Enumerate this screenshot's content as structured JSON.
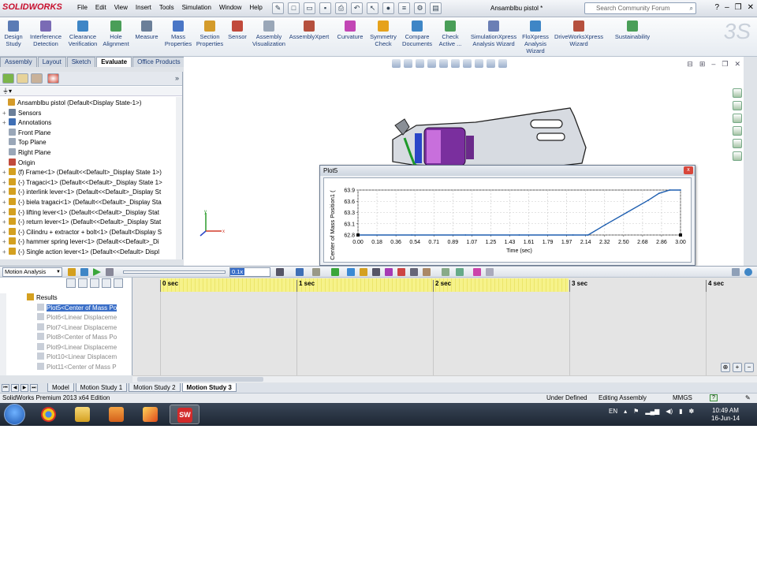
{
  "app": {
    "logo": "SOLIDWORKS",
    "menu": [
      "File",
      "Edit",
      "View",
      "Insert",
      "Tools",
      "Simulation",
      "Window",
      "Help"
    ],
    "document_title": "Ansamblbu pistol *",
    "search_placeholder": "Search Community Forum"
  },
  "ribbon": {
    "buttons": [
      {
        "label": "Design Study",
        "color": "#5b7bb5"
      },
      {
        "label": "Interference Detection",
        "color": "#7a6bb5"
      },
      {
        "label": "Clearance Verification",
        "color": "#3f86c6"
      },
      {
        "label": "Hole Alignment",
        "color": "#4a9e58"
      },
      {
        "label": "Measure",
        "color": "#6b7f99"
      },
      {
        "label": "Mass Properties",
        "color": "#4a76c6"
      },
      {
        "label": "Section Properties",
        "color": "#d49b2b"
      },
      {
        "label": "Sensor",
        "color": "#c14a3c"
      },
      {
        "label": "Assembly Visualization",
        "color": "#9aa7b8"
      },
      {
        "label": "AssemblyXpert",
        "color": "#b5503e"
      },
      {
        "label": "Curvature",
        "color": "#c246b5"
      },
      {
        "label": "Symmetry Check",
        "color": "#e6a21c"
      },
      {
        "label": "Compare Documents",
        "color": "#3f86c6"
      },
      {
        "label": "Check Active ...",
        "color": "#4a9e58"
      },
      {
        "label": "SimulationXpress Analysis Wizard",
        "color": "#6b7fb5"
      },
      {
        "label": "FloXpress Analysis Wizard",
        "color": "#3f86c6"
      },
      {
        "label": "DriveWorksXpress Wizard",
        "color": "#b5503e"
      },
      {
        "label": "Sustainability",
        "color": "#4a9e58"
      }
    ],
    "tabs": [
      "Assembly",
      "Layout",
      "Sketch",
      "Evaluate",
      "Office Products",
      "Simulation"
    ],
    "active_tab": "Evaluate"
  },
  "feature_tree": {
    "filter": "",
    "rows": [
      {
        "exp": "",
        "label": "Ansamblbu pistol  (Default<Display State-1>)",
        "color": "#d49b2b"
      },
      {
        "exp": "+",
        "label": "Sensors",
        "color": "#6b7f99"
      },
      {
        "exp": "+",
        "label": "Annotations",
        "color": "#3f6fb5"
      },
      {
        "exp": "",
        "label": "Front Plane",
        "color": "#9aa7b8"
      },
      {
        "exp": "",
        "label": "Top Plane",
        "color": "#9aa7b8"
      },
      {
        "exp": "",
        "label": "Right Plane",
        "color": "#9aa7b8"
      },
      {
        "exp": "",
        "label": "Origin",
        "color": "#c14a3c"
      },
      {
        "exp": "+",
        "label": "(f) Frame<1> (Default<<Default>_Display State 1>)",
        "color": "#d4a020"
      },
      {
        "exp": "+",
        "label": "(-) Tragaci<1> (Default<<Default>_Display State 1>",
        "color": "#d4a020"
      },
      {
        "exp": "+",
        "label": "(-) interlink lever<1> (Default<<Default>_Display St",
        "color": "#d4a020"
      },
      {
        "exp": "+",
        "label": "(-) biela tragaci<1> (Default<<Default>_Display Sta",
        "color": "#d4a020"
      },
      {
        "exp": "+",
        "label": "(-) lifting lever<1> (Default<<Default>_Display Stat",
        "color": "#d4a020"
      },
      {
        "exp": "+",
        "label": "(-) return lever<1> (Default<<Default>_Display Stat",
        "color": "#d4a020"
      },
      {
        "exp": "+",
        "label": "(-) Cilindru + extractor + bolt<1> (Default<Display S",
        "color": "#d4a020"
      },
      {
        "exp": "+",
        "label": "(-) hammer spring lever<1> (Default<<Default>_Di",
        "color": "#d4a020"
      },
      {
        "exp": "+",
        "label": "(-) Single action lever<1> (Default<<Default> Displ",
        "color": "#d4a020"
      }
    ]
  },
  "plot": {
    "window_title": "Plot5",
    "close_glyph": "x"
  },
  "chart_data": {
    "type": "line",
    "title": "",
    "xlabel": "Time (sec)",
    "ylabel": "Center of Mass Position1 (",
    "x_ticks": [
      "0.00",
      "0.18",
      "0.36",
      "0.54",
      "0.71",
      "0.89",
      "1.07",
      "1.25",
      "1.43",
      "1.61",
      "1.79",
      "1.97",
      "2.14",
      "2.32",
      "2.50",
      "2.68",
      "2.86",
      "3.00"
    ],
    "y_ticks": [
      "62.8",
      "63.1",
      "63.3",
      "63.6",
      "63.9"
    ],
    "xlim": [
      0,
      3.0
    ],
    "ylim": [
      62.8,
      63.9
    ],
    "grid": true,
    "series": [
      {
        "color": "#1f5fb0",
        "x": [
          0.0,
          0.5,
          1.0,
          1.5,
          2.0,
          2.14,
          2.3,
          2.5,
          2.7,
          2.8,
          2.9,
          3.0
        ],
        "y": [
          62.8,
          62.8,
          62.8,
          62.8,
          62.8,
          62.8,
          63.05,
          63.35,
          63.65,
          63.82,
          63.9,
          63.9
        ]
      }
    ]
  },
  "motion": {
    "study_type": "Motion Analysis",
    "zoom_value": "0.1x",
    "tree": [
      {
        "label": "Results",
        "kind": "res"
      },
      {
        "label": "Plot5<Center of Mass Po",
        "kind": "sel"
      },
      {
        "label": "Plot6<Linear Displaceme",
        "kind": ""
      },
      {
        "label": "Plot7<Linear Displaceme",
        "kind": ""
      },
      {
        "label": "Plot8<Center of Mass Po",
        "kind": ""
      },
      {
        "label": "Plot9<Linear Displaceme",
        "kind": ""
      },
      {
        "label": "Plot10<Linear Displacem",
        "kind": ""
      },
      {
        "label": "Plot11<Center of Mass P",
        "kind": ""
      }
    ],
    "timeline": [
      "0 sec",
      "1 sec",
      "2 sec",
      "3 sec",
      "4 sec"
    ],
    "study_tabs": [
      "Model",
      "Motion Study 1",
      "Motion Study 2",
      "Motion Study 3"
    ],
    "active_study_tab": "Motion Study 3"
  },
  "status": {
    "edition": "SolidWorks Premium 2013 x64 Edition",
    "state": "Under Defined",
    "mode": "Editing Assembly",
    "units": "MMGS"
  },
  "taskbar": {
    "lang": "EN",
    "time": "10:49 AM",
    "date": "16-Jun-14"
  }
}
